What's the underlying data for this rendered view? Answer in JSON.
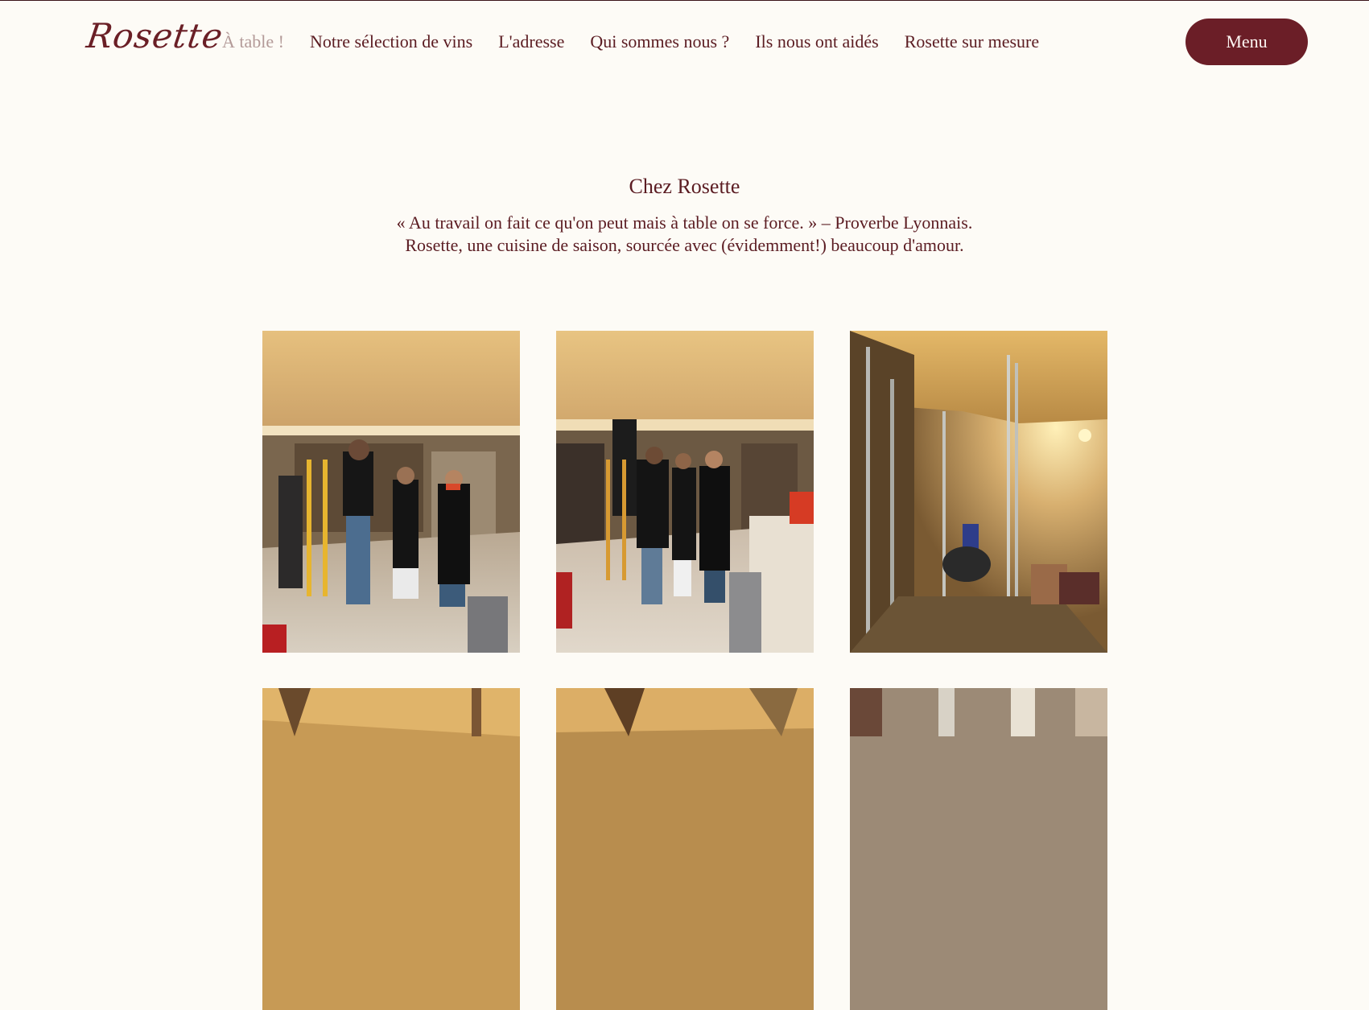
{
  "header": {
    "logo": "Rosette",
    "nav": [
      {
        "label": "À table !",
        "active": true
      },
      {
        "label": "Notre sélection de vins",
        "active": false
      },
      {
        "label": "L'adresse",
        "active": false
      },
      {
        "label": "Qui sommes nous ?",
        "active": false
      },
      {
        "label": "Ils nous ont aidés",
        "active": false
      },
      {
        "label": "Rosette sur mesure",
        "active": false
      }
    ],
    "menu_button": "Menu"
  },
  "intro": {
    "title": "Chez Rosette",
    "quote": "« Au travail on fait ce qu'on peut mais à table on se force. » – Proverbe Lyonnais.",
    "tagline": "Rosette, une cuisine de saison, sourcée avec (évidemment!) beaucoup d'amour."
  },
  "colors": {
    "background": "#fdfbf6",
    "brand": "#6b1e27",
    "text": "#5b1c22",
    "nav_active": "#b39a98"
  }
}
